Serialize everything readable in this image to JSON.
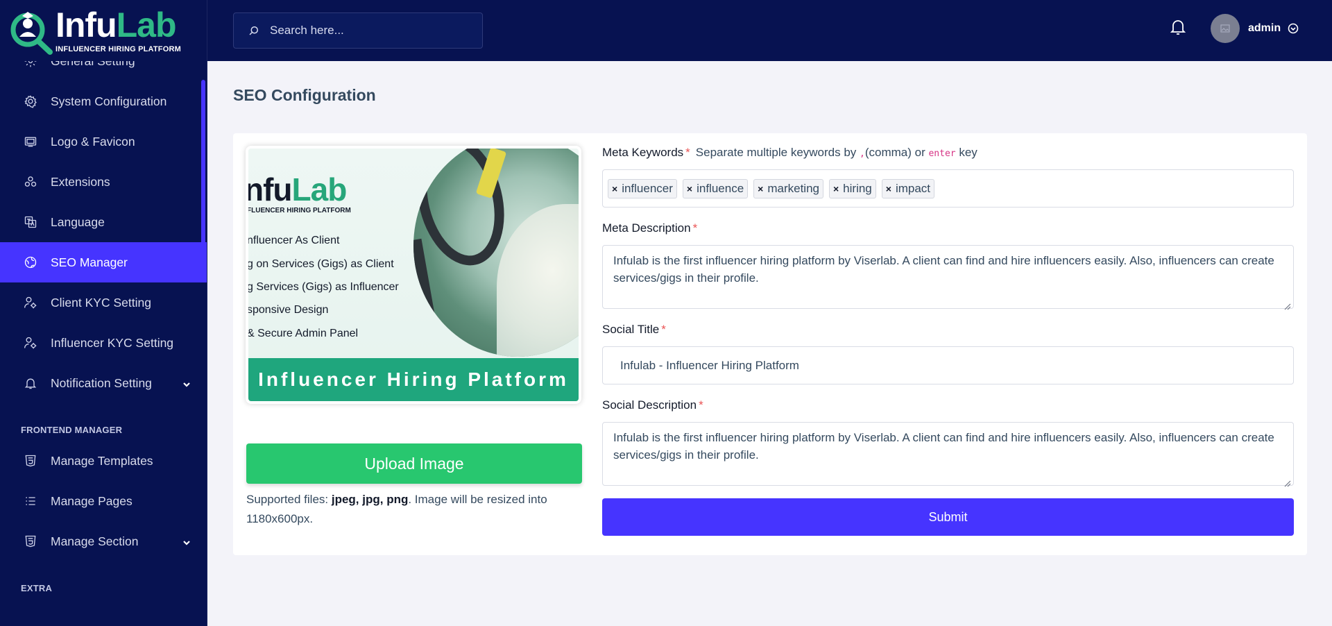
{
  "brand": {
    "name_part1": "Infu",
    "name_part2": "Lab",
    "tagline": "INFLUENCER HIRING PLATFORM",
    "primary_color": "#4634ff",
    "sidebar_bg": "#071251",
    "accent_green": "#28c76f",
    "logo_green": "#2fb986"
  },
  "header": {
    "search_placeholder": "Search here...",
    "search_icon": "search-icon",
    "notification_icon": "bell-icon",
    "user_name": "admin"
  },
  "sidebar": {
    "items": [
      {
        "label": "General Setting",
        "icon": "gear-icon"
      },
      {
        "label": "System Configuration",
        "icon": "cog-icon"
      },
      {
        "label": "Logo & Favicon",
        "icon": "image-icon"
      },
      {
        "label": "Extensions",
        "icon": "puzzle-icon"
      },
      {
        "label": "Language",
        "icon": "language-icon"
      },
      {
        "label": "SEO Manager",
        "icon": "globe-icon",
        "active": true
      },
      {
        "label": "Client KYC Setting",
        "icon": "user-cog-icon"
      },
      {
        "label": "Influencer KYC Setting",
        "icon": "user-cog-icon"
      },
      {
        "label": "Notification Setting",
        "icon": "bell-icon",
        "has_submenu": true
      }
    ],
    "frontend_heading": "FRONTEND MANAGER",
    "frontend_items": [
      {
        "label": "Manage Templates",
        "icon": "html5-icon"
      },
      {
        "label": "Manage Pages",
        "icon": "list-icon"
      },
      {
        "label": "Manage Section",
        "icon": "html5-icon",
        "has_submenu": true
      }
    ],
    "extra_heading": "EXTRA"
  },
  "page": {
    "title": "SEO Configuration"
  },
  "preview_image": {
    "logo_part1": "nfu",
    "logo_part2": "Lab",
    "tagline": "FLUENCER HIRING PLATFORM",
    "lines": [
      "nfluencer As Client",
      "g on Services (Gigs) as Client",
      "g Services (Gigs) as Influencer",
      "sponsive Design",
      "& Secure Admin Panel"
    ],
    "banner": "Influencer Hiring Platform"
  },
  "upload": {
    "button_label": "Upload Image",
    "supported_prefix": "Supported files: ",
    "supported_types": "jpeg, jpg, png",
    "supported_suffix": ". Image will be resized into 1180x600px."
  },
  "form": {
    "meta_keywords": {
      "label": "Meta Keywords",
      "required": "*",
      "hint_prefix": "Separate multiple keywords by ",
      "hint_code1": ",",
      "hint_middle": "(comma) or ",
      "hint_code2": "enter",
      "hint_suffix": " key",
      "tags": [
        "influencer",
        "influence",
        "marketing",
        "hiring",
        "impact"
      ],
      "tag_remove": "×"
    },
    "meta_description": {
      "label": "Meta Description",
      "required": "*",
      "value": "Infulab is the first influencer hiring platform by Viserlab. A client can find and hire influencers easily. Also, influencers can create services/gigs in their profile."
    },
    "social_title": {
      "label": "Social Title",
      "required": "*",
      "value": "Infulab - Influencer Hiring Platform"
    },
    "social_description": {
      "label": "Social Description",
      "required": "*",
      "value": "Infulab is the first influencer hiring platform by Viserlab. A client can find and hire influencers easily. Also, influencers can create services/gigs in their profile."
    },
    "submit_label": "Submit"
  }
}
